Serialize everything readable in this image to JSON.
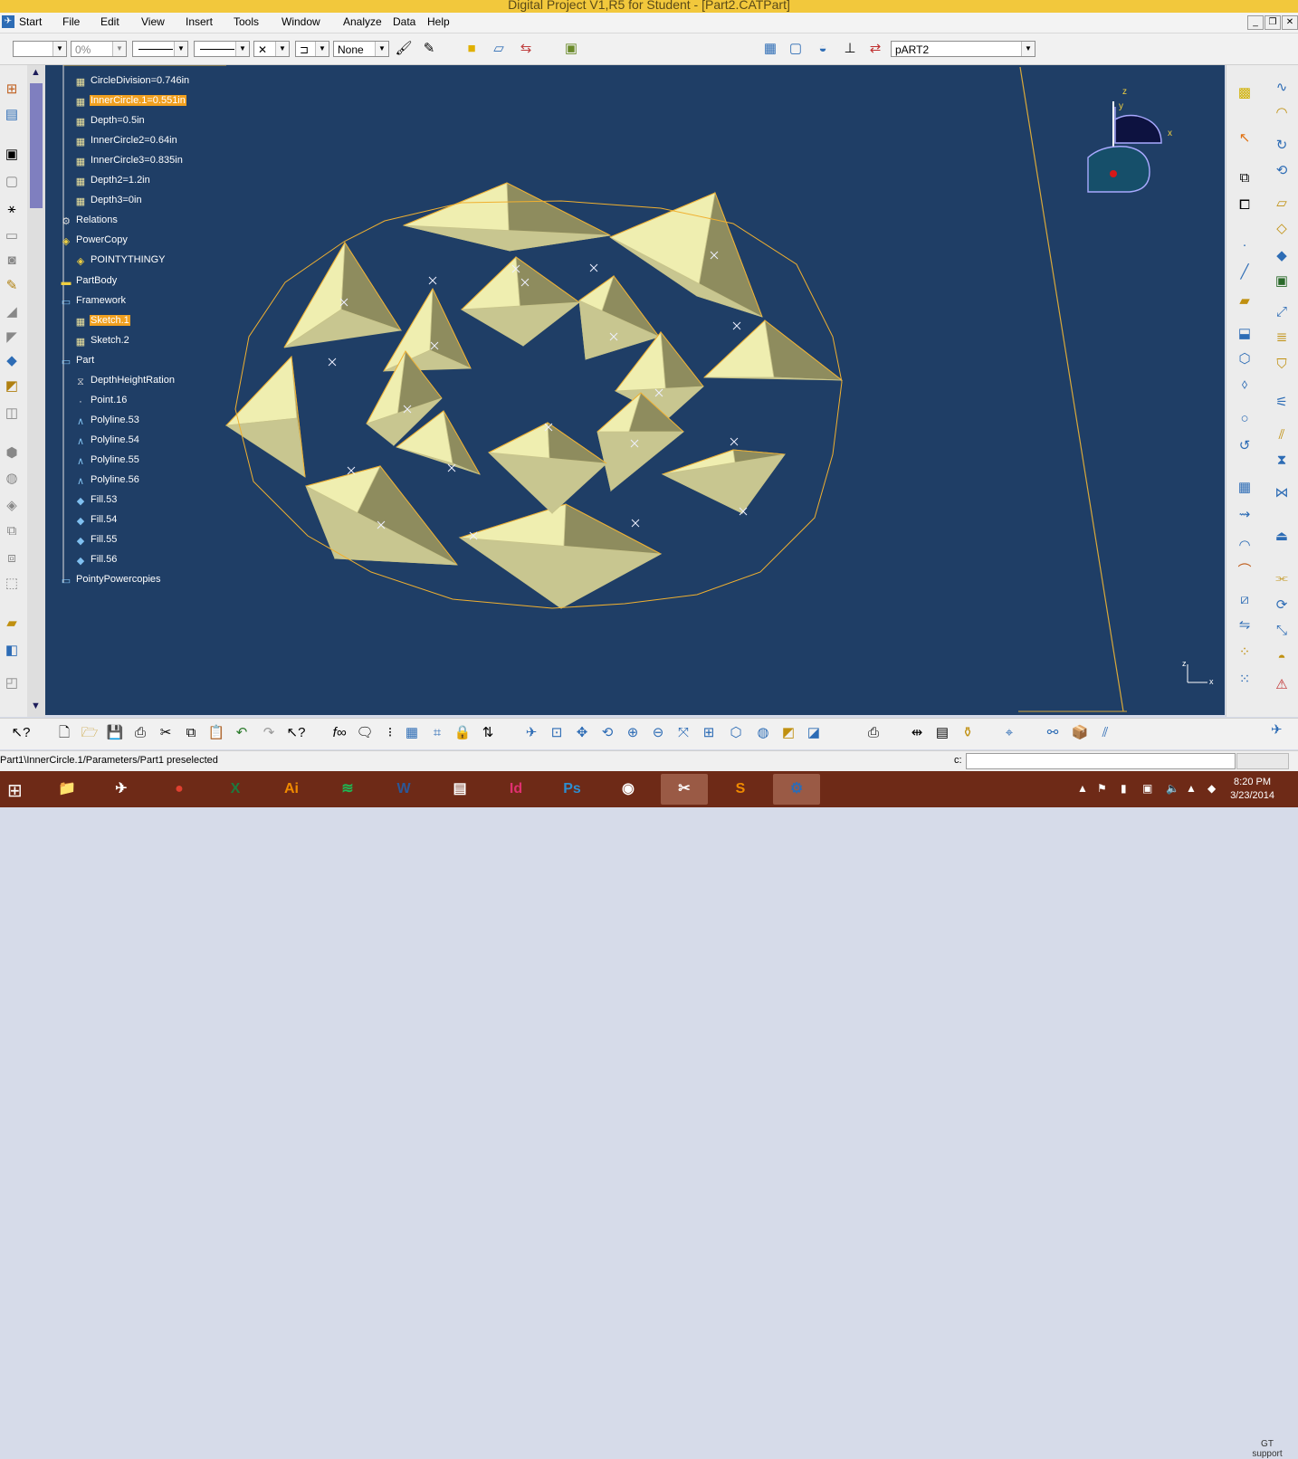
{
  "window": {
    "title": "Digital Project V1,R5 for Student - [Part2.CATPart]"
  },
  "menu": {
    "items": [
      "Start",
      "File",
      "Edit",
      "View",
      "Insert",
      "Tools",
      "Window",
      "Analyze",
      "Data",
      "Help"
    ]
  },
  "toolbar": {
    "percent_value": "0%",
    "none_value": "None",
    "part_selector": "pART2"
  },
  "tree": {
    "items": [
      {
        "label": "CircleDivision=0.746in",
        "icon": "parameter-icon",
        "selected": false
      },
      {
        "label": "InnerCircle.1=0.551in",
        "icon": "parameter-icon",
        "selected": true
      },
      {
        "label": "Depth=0.5in",
        "icon": "parameter-icon",
        "selected": false
      },
      {
        "label": "InnerCircle2=0.64in",
        "icon": "parameter-icon",
        "selected": false
      },
      {
        "label": "InnerCircle3=0.835in",
        "icon": "parameter-icon",
        "selected": false
      },
      {
        "label": "Depth2=1.2in",
        "icon": "parameter-icon",
        "selected": false
      },
      {
        "label": "Depth3=0in",
        "icon": "parameter-icon",
        "selected": false
      },
      {
        "label": "Relations",
        "icon": "relations-icon",
        "selected": false
      },
      {
        "label": "PowerCopy",
        "icon": "powercopy-icon",
        "selected": false
      },
      {
        "label": "POINTYTHINGY",
        "icon": "powercopy-icon",
        "selected": false
      },
      {
        "label": "PartBody",
        "icon": "body-icon",
        "selected": false
      },
      {
        "label": "Framework",
        "icon": "geometrical-set-icon",
        "selected": false
      },
      {
        "label": "Sketch.1",
        "icon": "sketch-icon",
        "selected": true
      },
      {
        "label": "Sketch.2",
        "icon": "sketch-icon",
        "selected": false
      },
      {
        "label": "Part",
        "icon": "geometrical-set-icon",
        "selected": false
      },
      {
        "label": "DepthHeightRation",
        "icon": "law-icon",
        "selected": false
      },
      {
        "label": "Point.16",
        "icon": "point-icon",
        "selected": false
      },
      {
        "label": "Polyline.53",
        "icon": "polyline-icon",
        "selected": false
      },
      {
        "label": "Polyline.54",
        "icon": "polyline-icon",
        "selected": false
      },
      {
        "label": "Polyline.55",
        "icon": "polyline-icon",
        "selected": false
      },
      {
        "label": "Polyline.56",
        "icon": "polyline-icon",
        "selected": false
      },
      {
        "label": "Fill.53",
        "icon": "fill-icon",
        "selected": false
      },
      {
        "label": "Fill.54",
        "icon": "fill-icon",
        "selected": false
      },
      {
        "label": "Fill.55",
        "icon": "fill-icon",
        "selected": false
      },
      {
        "label": "Fill.56",
        "icon": "fill-icon",
        "selected": false
      },
      {
        "label": "PointyPowercopies",
        "icon": "geometrical-set-icon",
        "selected": false
      }
    ]
  },
  "compass": {
    "x_label": "x",
    "y_label": "y",
    "z_label": "z"
  },
  "axis_triad": {
    "z_label": "z",
    "x_label": "x"
  },
  "status": {
    "message": "Part1\\InnerCircle.1/Parameters/Part1 preselected",
    "command_label": "c:"
  },
  "gt_support": {
    "line1": "GT",
    "line2": "support"
  },
  "taskbar": {
    "apps": [
      {
        "name": "file-explorer-icon",
        "text": "📁",
        "active": false
      },
      {
        "name": "catia-icon",
        "text": "✈",
        "active": false
      },
      {
        "name": "chrome-icon",
        "text": "●",
        "active": false
      },
      {
        "name": "excel-icon",
        "text": "X",
        "active": false
      },
      {
        "name": "illustrator-icon",
        "text": "Ai",
        "active": false
      },
      {
        "name": "spotify-icon",
        "text": "≋",
        "active": false
      },
      {
        "name": "word-icon",
        "text": "W",
        "active": false
      },
      {
        "name": "project-icon",
        "text": "▤",
        "active": false
      },
      {
        "name": "indesign-icon",
        "text": "Id",
        "active": false
      },
      {
        "name": "photoshop-icon",
        "text": "Ps",
        "active": false
      },
      {
        "name": "gimp-icon",
        "text": "◉",
        "active": false
      },
      {
        "name": "snipping-tool-icon",
        "text": "✂",
        "active": true
      },
      {
        "name": "sublime-icon",
        "text": "S",
        "active": false
      },
      {
        "name": "digital-project-icon",
        "text": "⚙",
        "active": true
      }
    ],
    "time": "8:20 PM",
    "date": "3/23/2014"
  },
  "colors": {
    "viewport_bg": "#1f3e66",
    "face_light": "#efeeb0",
    "face_dark": "#8e8c5e",
    "edge": "#f0b030",
    "selection": "#f0a020",
    "taskbar": "#6e2a17",
    "titlebar": "#f2c83c"
  }
}
